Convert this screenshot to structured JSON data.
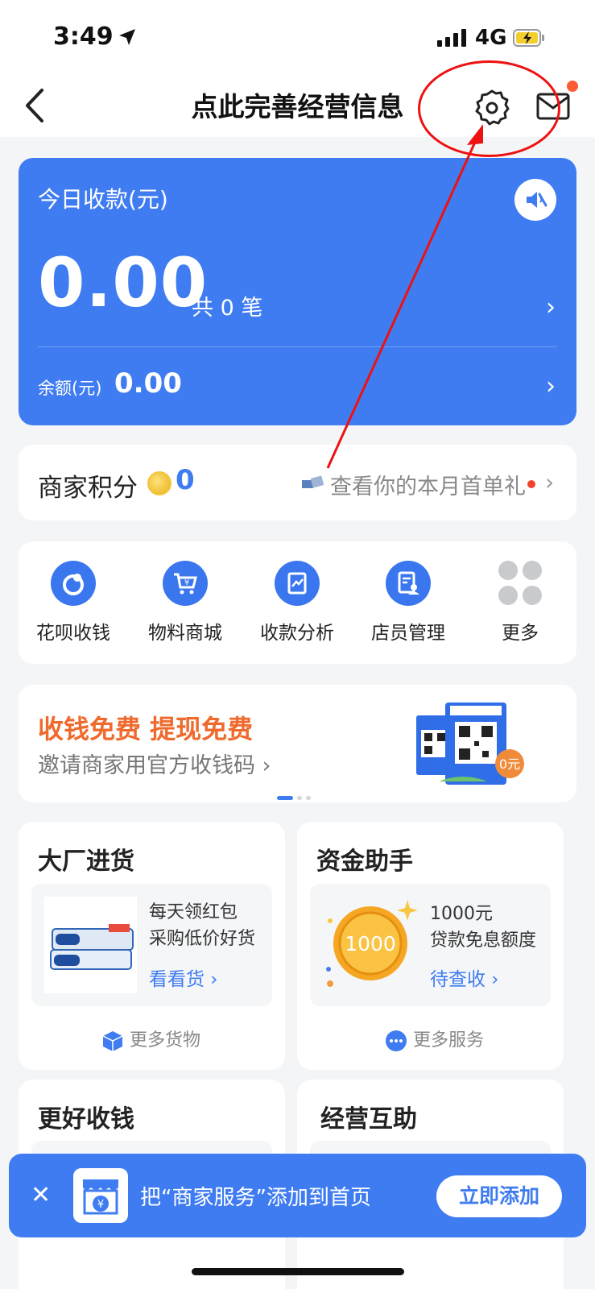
{
  "status_bar": {
    "time": "3:49",
    "network": "4G"
  },
  "header": {
    "title": "点此完善经营信息"
  },
  "income": {
    "title": "今日收款(元)",
    "amount": "0.00",
    "count": "共 0 笔",
    "balance_label": "余额(元)",
    "balance_value": "0.00"
  },
  "points": {
    "label": "商家积分",
    "value": "0",
    "link": "查看你的本月首单礼"
  },
  "menu": {
    "items": [
      {
        "label": "花呗收钱",
        "icon": "huabei-icon"
      },
      {
        "label": "物料商城",
        "icon": "cart-icon"
      },
      {
        "label": "收款分析",
        "icon": "chart-icon"
      },
      {
        "label": "店员管理",
        "icon": "staff-icon"
      },
      {
        "label": "更多",
        "icon": "more-icon"
      }
    ]
  },
  "promo": {
    "title": "收钱免费 提现免费",
    "subtitle": "邀请商家用官方收钱码",
    "art_badge": "0元"
  },
  "purchase": {
    "title": "大厂进货",
    "line1": "每天领红包",
    "line2": "采购低价好货",
    "link": "看看货",
    "footer": "更多货物"
  },
  "funds": {
    "title": "资金助手",
    "coin_value": "1000",
    "line1": "1000元",
    "line2": "贷款免息额度",
    "link": "待查收",
    "footer": "更多服务"
  },
  "better": {
    "title": "更好收钱"
  },
  "mutual": {
    "title": "经营互助"
  },
  "banner": {
    "text": "把“商家服务”添加到首页",
    "button": "立即添加"
  },
  "colors": {
    "brand_blue": "#3f7cf1",
    "promo_orange": "#ef6a2c",
    "annotation_red": "#ee1111"
  }
}
